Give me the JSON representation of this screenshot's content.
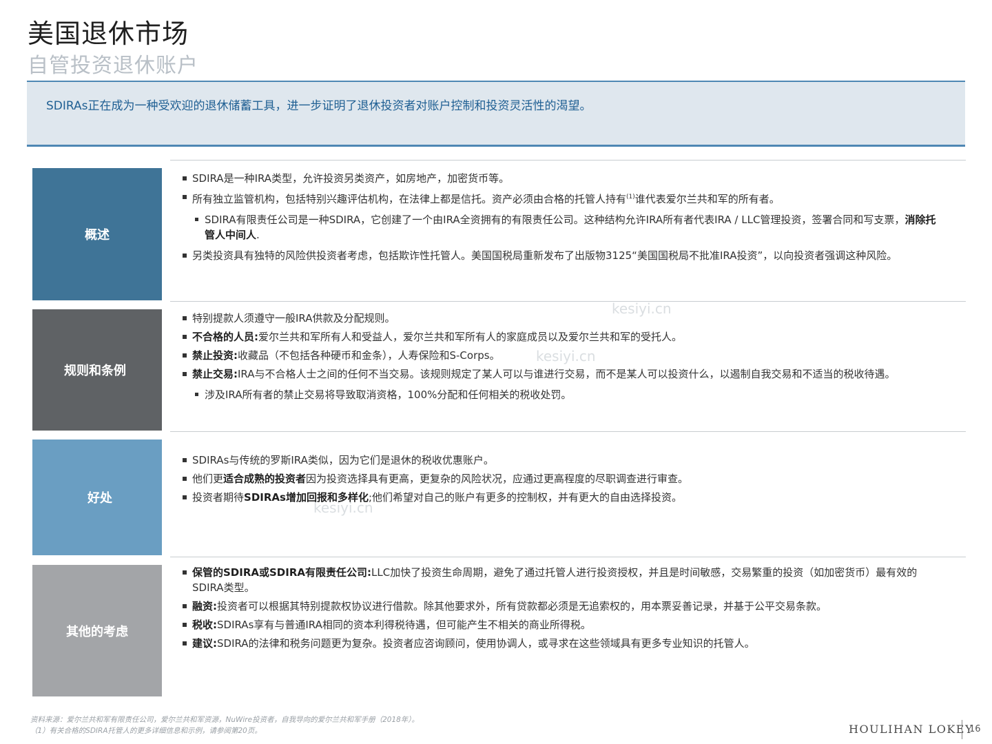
{
  "header": {
    "title": "美国退休市场",
    "subtitle": "自管投资退休账户"
  },
  "banner": {
    "text": "SDIRAs正在成为一种受欢迎的退休储蓄工具，进一步证明了退休投资者对账户控制和投资灵活性的渴望。"
  },
  "sections": [
    {
      "label": "概述",
      "color": "#3f7497",
      "items": [
        {
          "text": "SDIRA是一种IRA类型，允许投资另类资产，如房地产，加密货币等。"
        },
        {
          "pre": "所有独立监管机构，包括特别兴趣评估机构，在法律上都是信托。资产必须由合格的托管人持有",
          "sup": "(1)",
          "post": "谁代表爱尔兰共和军的所有者。"
        },
        {
          "pre": "SDIRA有限责任公司是一种SDIRA，它创建了一个由IRA全资拥有的有限责任公司。这种结构允许IRA所有者代表IRA / LLC管理投资，签署合同和写支票，",
          "bold": "消除托管人中间人",
          "post": "."
        },
        {
          "text": "另类投资具有独特的风险供投资者考虑，包括欺诈性托管人。美国国税局重新发布了出版物3125“美国国税局不批准IRA投资”，以向投资者强调这种风险。"
        }
      ]
    },
    {
      "label": "规则和条例",
      "color": "#5f6265",
      "items": [
        {
          "text": "特别提款人须遵守一般IRA供款及分配规则。"
        },
        {
          "bold": "不合格的人员:",
          "text": "爱尔兰共和军所有人和受益人，爱尔兰共和军所有人的家庭成员以及爱尔兰共和军的受托人。"
        },
        {
          "bold": "禁止投资:",
          "text": "收藏品（不包括各种硬币和金条），人寿保险和S-Corps。"
        },
        {
          "bold": "禁止交易:",
          "text": "IRA与不合格人士之间的任何不当交易。该规则规定了某人可以与谁进行交易，而不是某人可以投资什么，以遏制自我交易和不适当的税收待遇。"
        },
        {
          "text": "涉及IRA所有者的禁止交易将导致取消资格，100%分配和任何相关的税收处罚。"
        }
      ]
    },
    {
      "label": "好处",
      "color": "#6a9ec2",
      "items": [
        {
          "text": "SDIRAs与传统的罗斯IRA类似，因为它们是退休的税收优惠账户。"
        },
        {
          "pre": "他们更",
          "bold": "适合成熟的投资者",
          "post": "因为投资选择具有更高，更复杂的风险状况，应通过更高程度的尽职调查进行审查。"
        },
        {
          "pre": "投资者期待",
          "bold": "SDIRAs增加回报和多样化",
          "post": ";他们希望对自己的账户有更多的控制权，并有更大的自由选择投资。"
        }
      ]
    },
    {
      "label": "其他的考虑",
      "color": "#a3a5a8",
      "items": [
        {
          "bold": "保管的SDIRA或SDIRA有限责任公司:",
          "text": "LLC加快了投资生命周期，避免了通过托管人进行投资授权，并且是时间敏感，交易繁重的投资（如加密货币）最有效的SDIRA类型。"
        },
        {
          "bold": "融资:",
          "text": "投资者可以根据其特别提款权协议进行借款。除其他要求外，所有贷款都必须是无追索权的，用本票妥善记录，并基于公平交易条款。"
        },
        {
          "bold": "税收:",
          "text": "SDIRAs享有与普通IRA相同的资本利得税待遇，但可能产生不相关的商业所得税。"
        },
        {
          "bold": "建议:",
          "text": "SDIRA的法律和税务问题更为复杂。投资者应咨询顾问，使用协调人，或寻求在这些领域具有更多专业知识的托管人。"
        }
      ]
    }
  ],
  "footer": {
    "source": "资料来源：爱尔兰共和军有限责任公司，爱尔兰共和军资源，NuWire投资者，自我导向的爱尔兰共和军手册（2018年）。",
    "note": "（1）有关合格的SDIRA托管人的更多详细信息和示例，请参阅第20页。",
    "brand": "HOULIHAN LOKEY",
    "page": "16"
  },
  "watermark": "kesiyi.cn"
}
